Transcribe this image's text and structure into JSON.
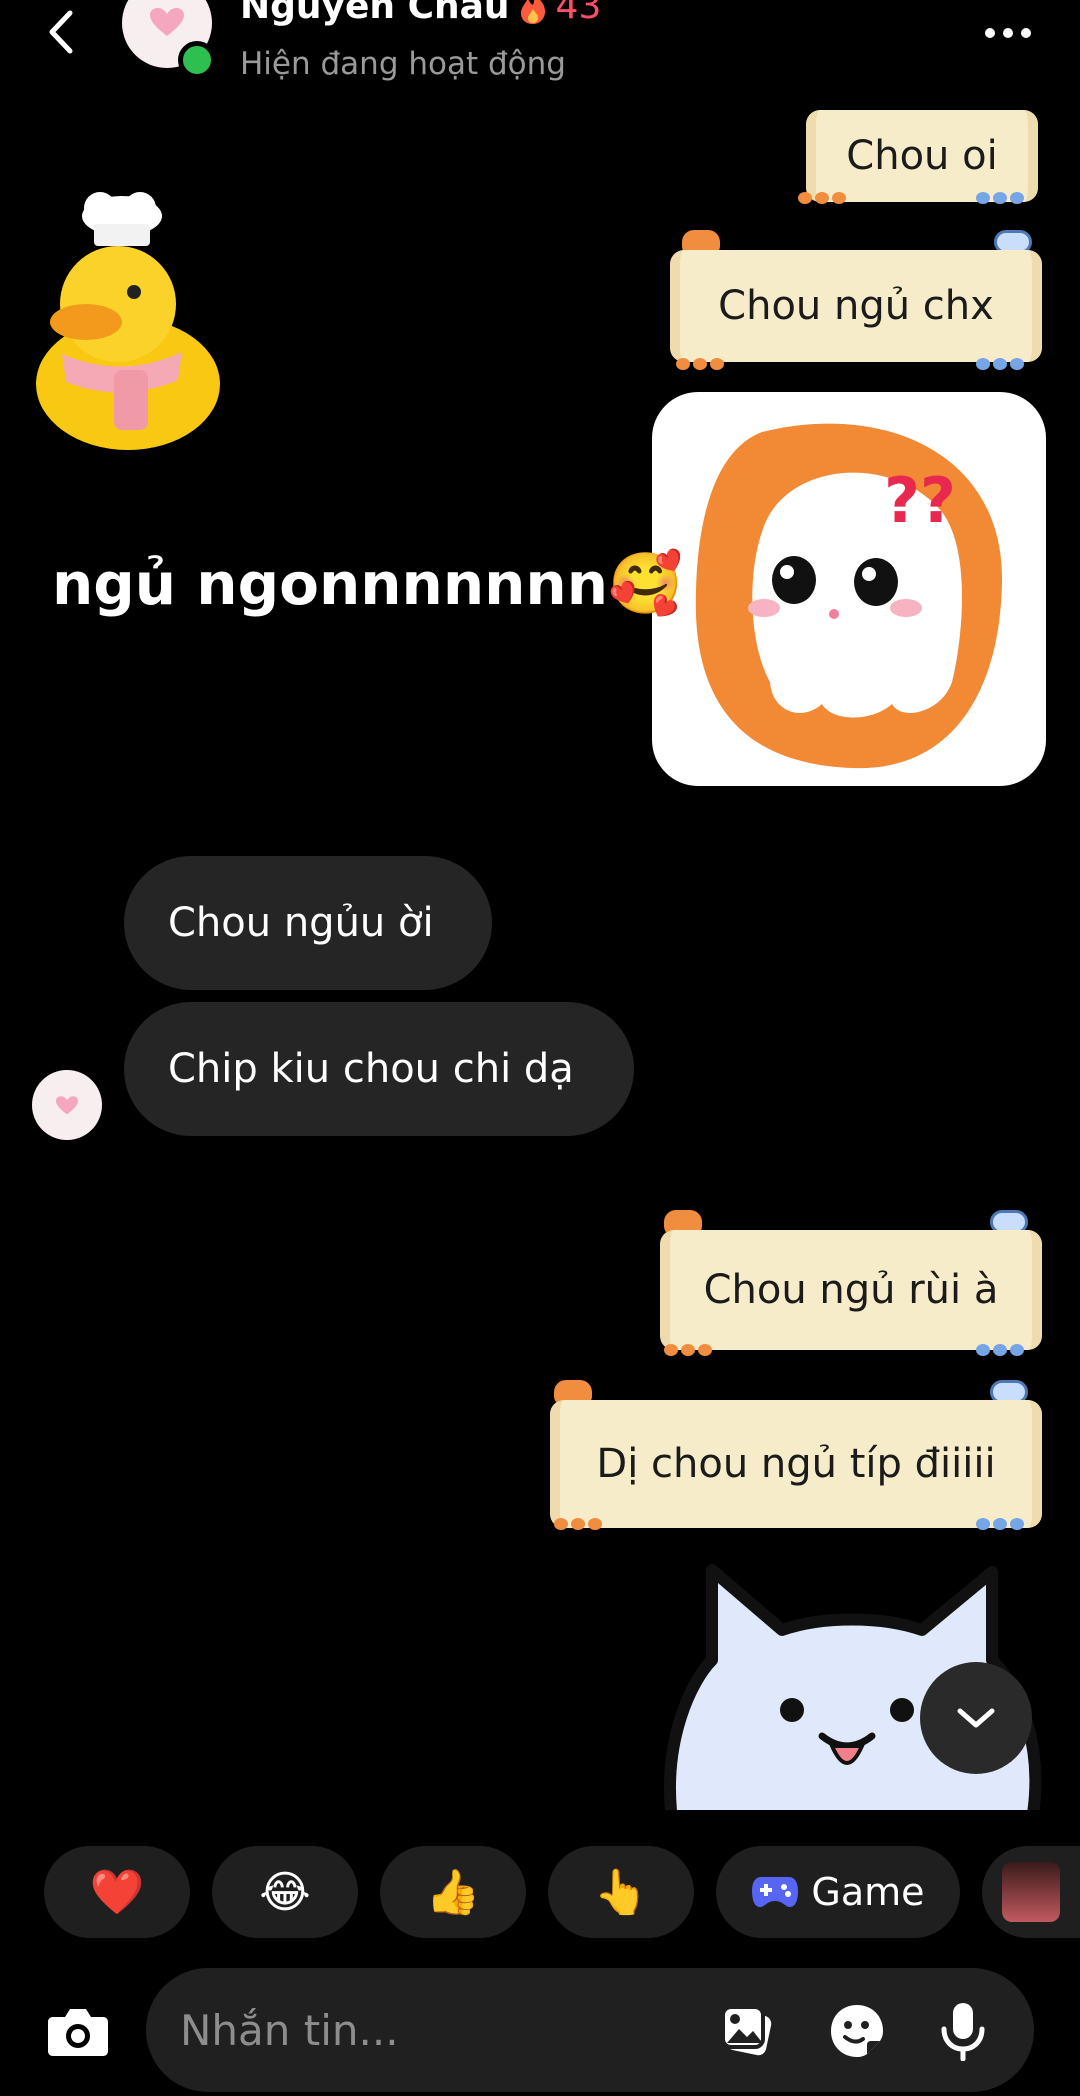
{
  "header": {
    "contact_name": "Nguyễn Châu",
    "streak_count": "43",
    "status": "Hiện đang hoạt động"
  },
  "messages": [
    {
      "side": "sent",
      "kind": "note",
      "text": "Chou oi"
    },
    {
      "side": "sent",
      "kind": "note",
      "text": "Chou ngủ chx"
    },
    {
      "side": "received",
      "kind": "sticker",
      "sticker": "duck-chef"
    },
    {
      "side": "sent",
      "kind": "sticker",
      "sticker": "confused-ghost"
    },
    {
      "side": "received",
      "kind": "text",
      "text": "ngủ ngonnnnnnn",
      "emoji": "🥰"
    },
    {
      "side": "received",
      "kind": "bubble",
      "text": "Chou ngủu ời"
    },
    {
      "side": "received",
      "kind": "bubble",
      "text": "Chip kiu chou chi dạ"
    },
    {
      "side": "sent",
      "kind": "note",
      "text": "Chou ngủ rùi à"
    },
    {
      "side": "sent",
      "kind": "note",
      "text": "Dị chou ngủ típ điiiii"
    },
    {
      "side": "sent",
      "kind": "sticker",
      "sticker": "white-cat"
    }
  ],
  "quick_reactions": [
    {
      "emoji": "❤️",
      "icon": "heart-icon"
    },
    {
      "emoji": "😂",
      "icon": "laughing-face-icon"
    },
    {
      "emoji": "👍",
      "icon": "thumbs-up-icon"
    },
    {
      "emoji": "👆",
      "icon": "pointing-up-icon"
    },
    {
      "label": "Game",
      "icon": "gamepad-icon"
    }
  ],
  "composer": {
    "placeholder": "Nhắn tin..."
  },
  "colors": {
    "background": "#000000",
    "note_paper": "#f7ecc9",
    "received_bubble": "#252525",
    "online_dot": "#2ec04f",
    "streak": "#ff4d6a",
    "game_icon": "#5865f2"
  }
}
